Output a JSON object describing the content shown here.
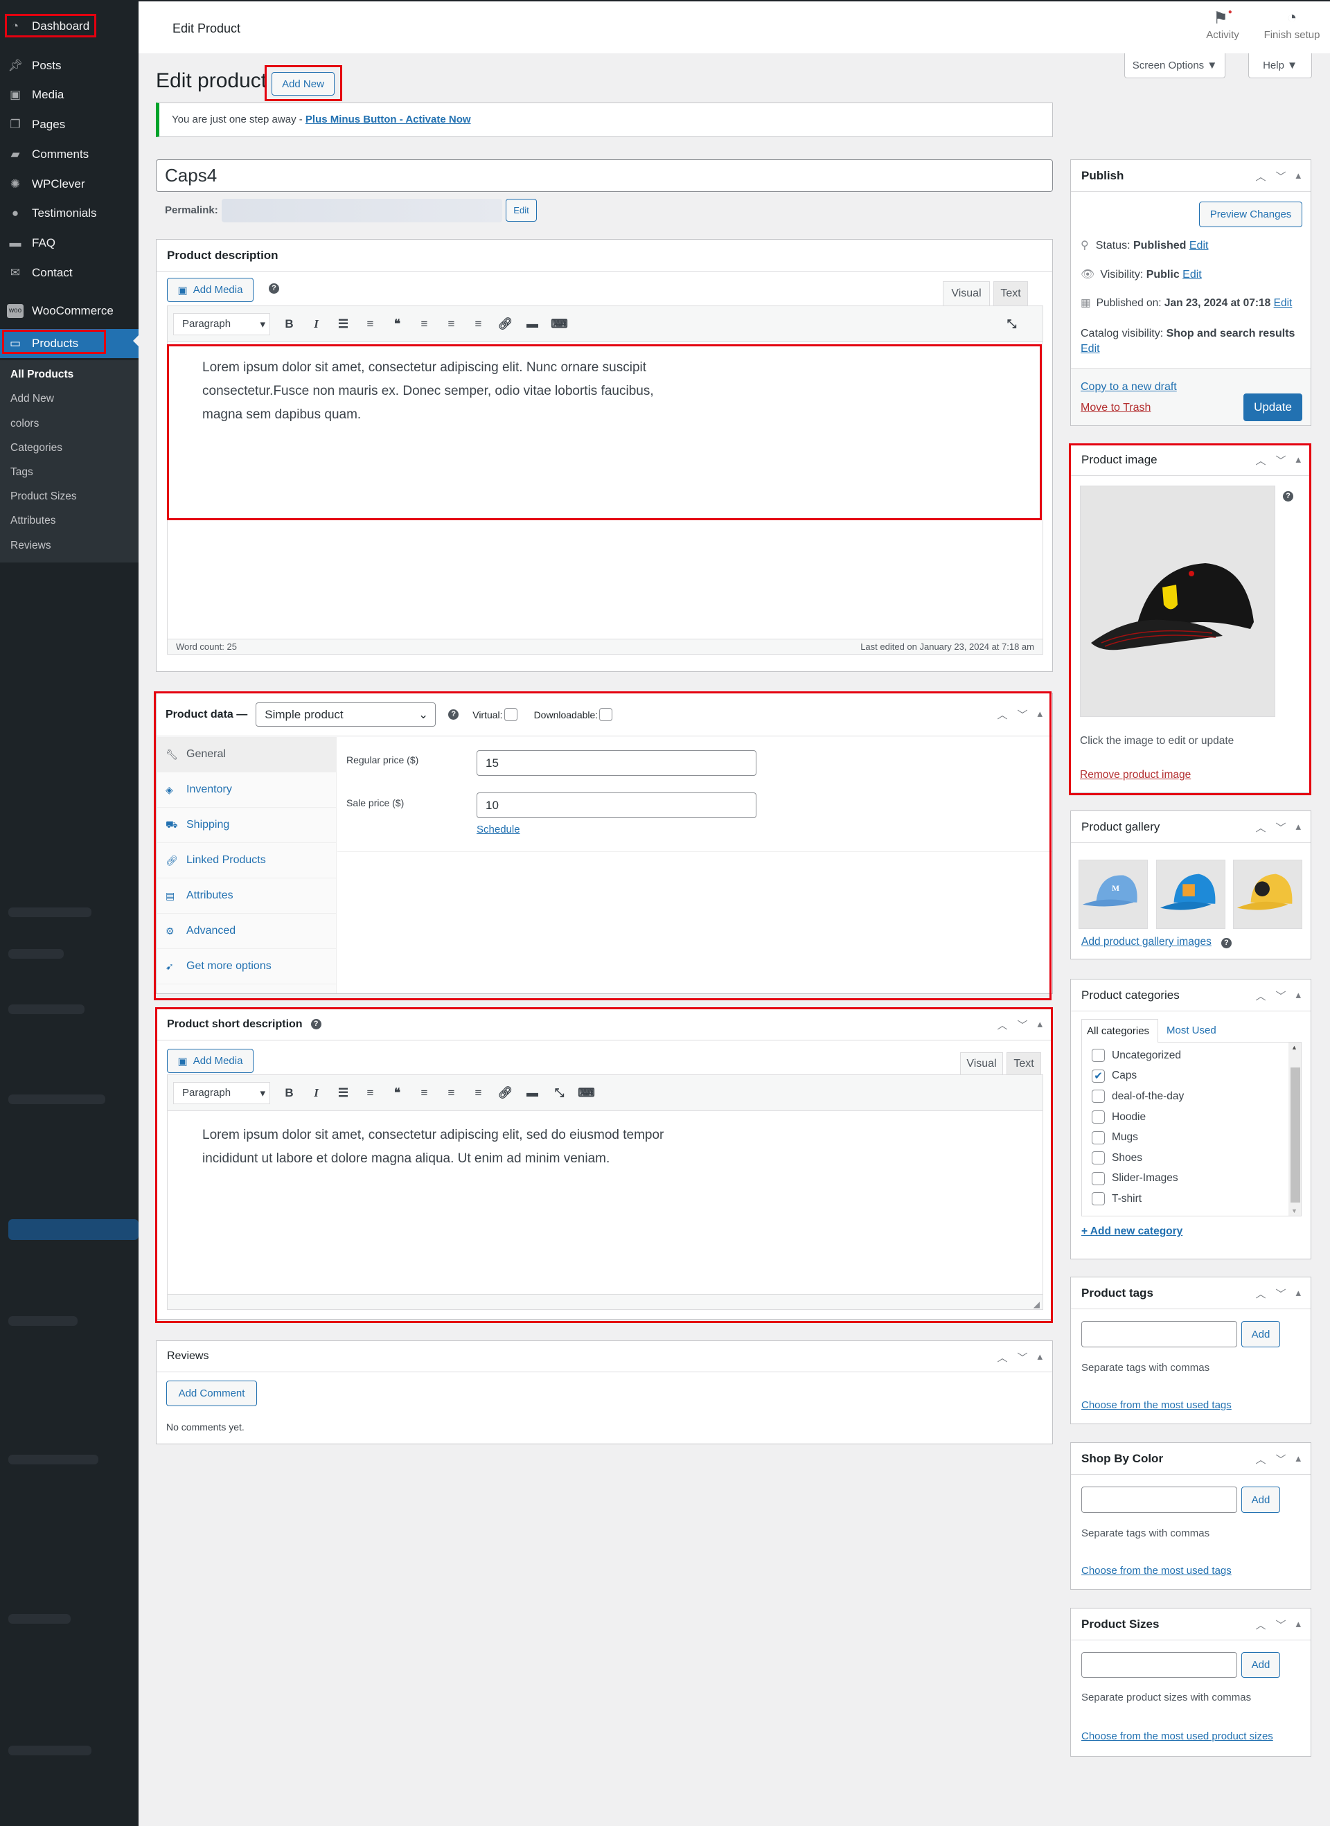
{
  "sidebar": {
    "items": [
      {
        "label": "Dashboard",
        "icon": "dashboard-icon"
      },
      {
        "label": "Posts",
        "icon": "pin-icon"
      },
      {
        "label": "Media",
        "icon": "media-icon"
      },
      {
        "label": "Pages",
        "icon": "pages-icon"
      },
      {
        "label": "Comments",
        "icon": "comment-icon"
      },
      {
        "label": "WPClever",
        "icon": "bulb-icon"
      },
      {
        "label": "Testimonials",
        "icon": "user-icon"
      },
      {
        "label": "FAQ",
        "icon": "folder-icon"
      },
      {
        "label": "Contact",
        "icon": "envelope-icon"
      },
      {
        "label": "WooCommerce",
        "icon": "woo-icon"
      },
      {
        "label": "Products",
        "icon": "archive-icon"
      }
    ],
    "submenu": [
      "All Products",
      "Add New",
      "colors",
      "Categories",
      "Tags",
      "Product Sizes",
      "Attributes",
      "Reviews"
    ]
  },
  "topbar": {
    "title": "Edit Product",
    "activity": "Activity",
    "finish_setup": "Finish setup",
    "screen_options": "Screen Options ▼",
    "help": "Help ▼"
  },
  "page": {
    "heading": "Edit product",
    "add_new": "Add New",
    "notice_text": "You are just one step away - ",
    "notice_link": "Plus Minus Button - Activate Now",
    "title_value": "Caps4",
    "permalink_label": "Permalink:",
    "permalink_edit": "Edit"
  },
  "description": {
    "title": "Product description",
    "add_media": "Add Media",
    "tab_visual": "Visual",
    "tab_text": "Text",
    "format": "Paragraph",
    "content": "Lorem ipsum dolor sit amet, consectetur adipiscing elit. Nunc ornare suscipit consectetur.Fusce non mauris ex. Donec semper, odio vitae lobortis faucibus, magna sem dapibus quam.",
    "word_count": "Word count: 25",
    "last_edited": "Last edited on January 23, 2024 at 7:18 am"
  },
  "product_data": {
    "title": "Product data —",
    "type": "Simple product",
    "virtual_label": "Virtual:",
    "downloadable_label": "Downloadable:",
    "tabs": [
      {
        "label": "General",
        "icon": "wrench-icon"
      },
      {
        "label": "Inventory",
        "icon": "tag-icon"
      },
      {
        "label": "Shipping",
        "icon": "truck-icon"
      },
      {
        "label": "Linked Products",
        "icon": "link-icon"
      },
      {
        "label": "Attributes",
        "icon": "list-icon"
      },
      {
        "label": "Advanced",
        "icon": "gear-icon"
      },
      {
        "label": "Get more options",
        "icon": "plug-icon"
      }
    ],
    "regular_price_label": "Regular price ($)",
    "regular_price": "15",
    "sale_price_label": "Sale price ($)",
    "sale_price": "10",
    "schedule": "Schedule"
  },
  "short_description": {
    "title": "Product short description",
    "add_media": "Add Media",
    "tab_visual": "Visual",
    "tab_text": "Text",
    "format": "Paragraph",
    "content": "Lorem ipsum dolor sit amet, consectetur adipiscing elit, sed do eiusmod tempor incididunt ut labore et dolore magna aliqua. Ut enim ad minim veniam."
  },
  "reviews": {
    "title": "Reviews",
    "add_comment": "Add Comment",
    "empty": "No comments yet."
  },
  "publish": {
    "title": "Publish",
    "preview": "Preview Changes",
    "status_label": "Status: ",
    "status": "Published",
    "visibility_label": "Visibility: ",
    "visibility": "Public",
    "published_label": "Published on: ",
    "published": "Jan 23, 2024 at 07:18",
    "catalog_label": "Catalog visibility: ",
    "catalog": "Shop and search results",
    "edit": "Edit",
    "copy_draft": "Copy to a new draft",
    "trash": "Move to Trash",
    "update": "Update"
  },
  "product_image": {
    "title": "Product image",
    "hint": "Click the image to edit or update",
    "remove": "Remove product image"
  },
  "gallery": {
    "title": "Product gallery",
    "add": "Add product gallery images"
  },
  "categories": {
    "title": "Product categories",
    "tab_all": "All categories",
    "tab_most": "Most Used",
    "items": [
      {
        "label": "Uncategorized",
        "checked": false
      },
      {
        "label": "Caps",
        "checked": true
      },
      {
        "label": "deal-of-the-day",
        "checked": false
      },
      {
        "label": "Hoodie",
        "checked": false
      },
      {
        "label": "Mugs",
        "checked": false
      },
      {
        "label": "Shoes",
        "checked": false
      },
      {
        "label": "Slider-Images",
        "checked": false
      },
      {
        "label": "T-shirt",
        "checked": false
      }
    ],
    "add_new": "+ Add new category"
  },
  "tags": {
    "title": "Product tags",
    "add": "Add",
    "hint": "Separate tags with commas",
    "choose": "Choose from the most used tags"
  },
  "color": {
    "title": "Shop By Color",
    "add": "Add",
    "hint": "Separate tags with commas",
    "choose": "Choose from the most used tags"
  },
  "sizes": {
    "title": "Product Sizes",
    "add": "Add",
    "hint": "Separate product sizes with commas",
    "choose": "Choose from the most used product sizes"
  },
  "colors": {
    "accent": "#2271b1",
    "highlight": "#e4000f",
    "sidebar": "#1d2327"
  }
}
